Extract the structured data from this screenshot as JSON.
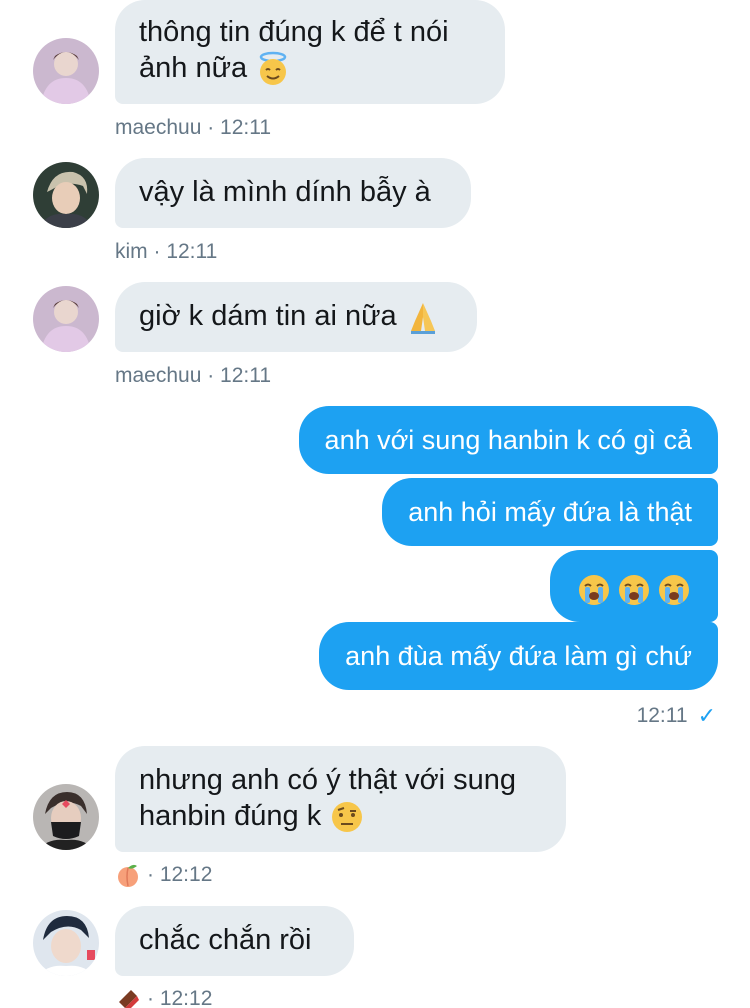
{
  "messages": [
    {
      "sender": "maechuu",
      "text_line1": "thông tin đúng k để t nói",
      "text_line2": "ảnh nữa",
      "emoji": "halo-face",
      "meta": "maechuu · 12:11"
    },
    {
      "sender": "kim",
      "text": "vậy là mình dính bẫy à",
      "meta": "kim · 12:11"
    },
    {
      "sender": "maechuu",
      "text": "giờ k dám tin ai nữa",
      "emoji": "folded-hands",
      "meta": "maechuu · 12:11"
    },
    {
      "outgoing": [
        "anh với sung hanbin k có gì cả",
        "anh hỏi mấy đứa là thật",
        "😭😭😭",
        "anh đùa mấy đứa làm gì chứ"
      ],
      "time": "12:11",
      "status_icon": "check-icon"
    },
    {
      "sender_emoji": "peach",
      "text_line1": "nhưng anh có ý thật với sung",
      "text_line2": "hanbin đúng k",
      "emoji": "raised-eyebrow-face",
      "meta": "· 12:12"
    },
    {
      "sender_emoji": "chocolate-bar",
      "text": "chắc chắn rồi",
      "meta": "· 12:12"
    }
  ],
  "colors": {
    "incoming_bubble": "#e6ecf0",
    "outgoing_bubble": "#1da1f2",
    "meta_text": "#657786"
  }
}
